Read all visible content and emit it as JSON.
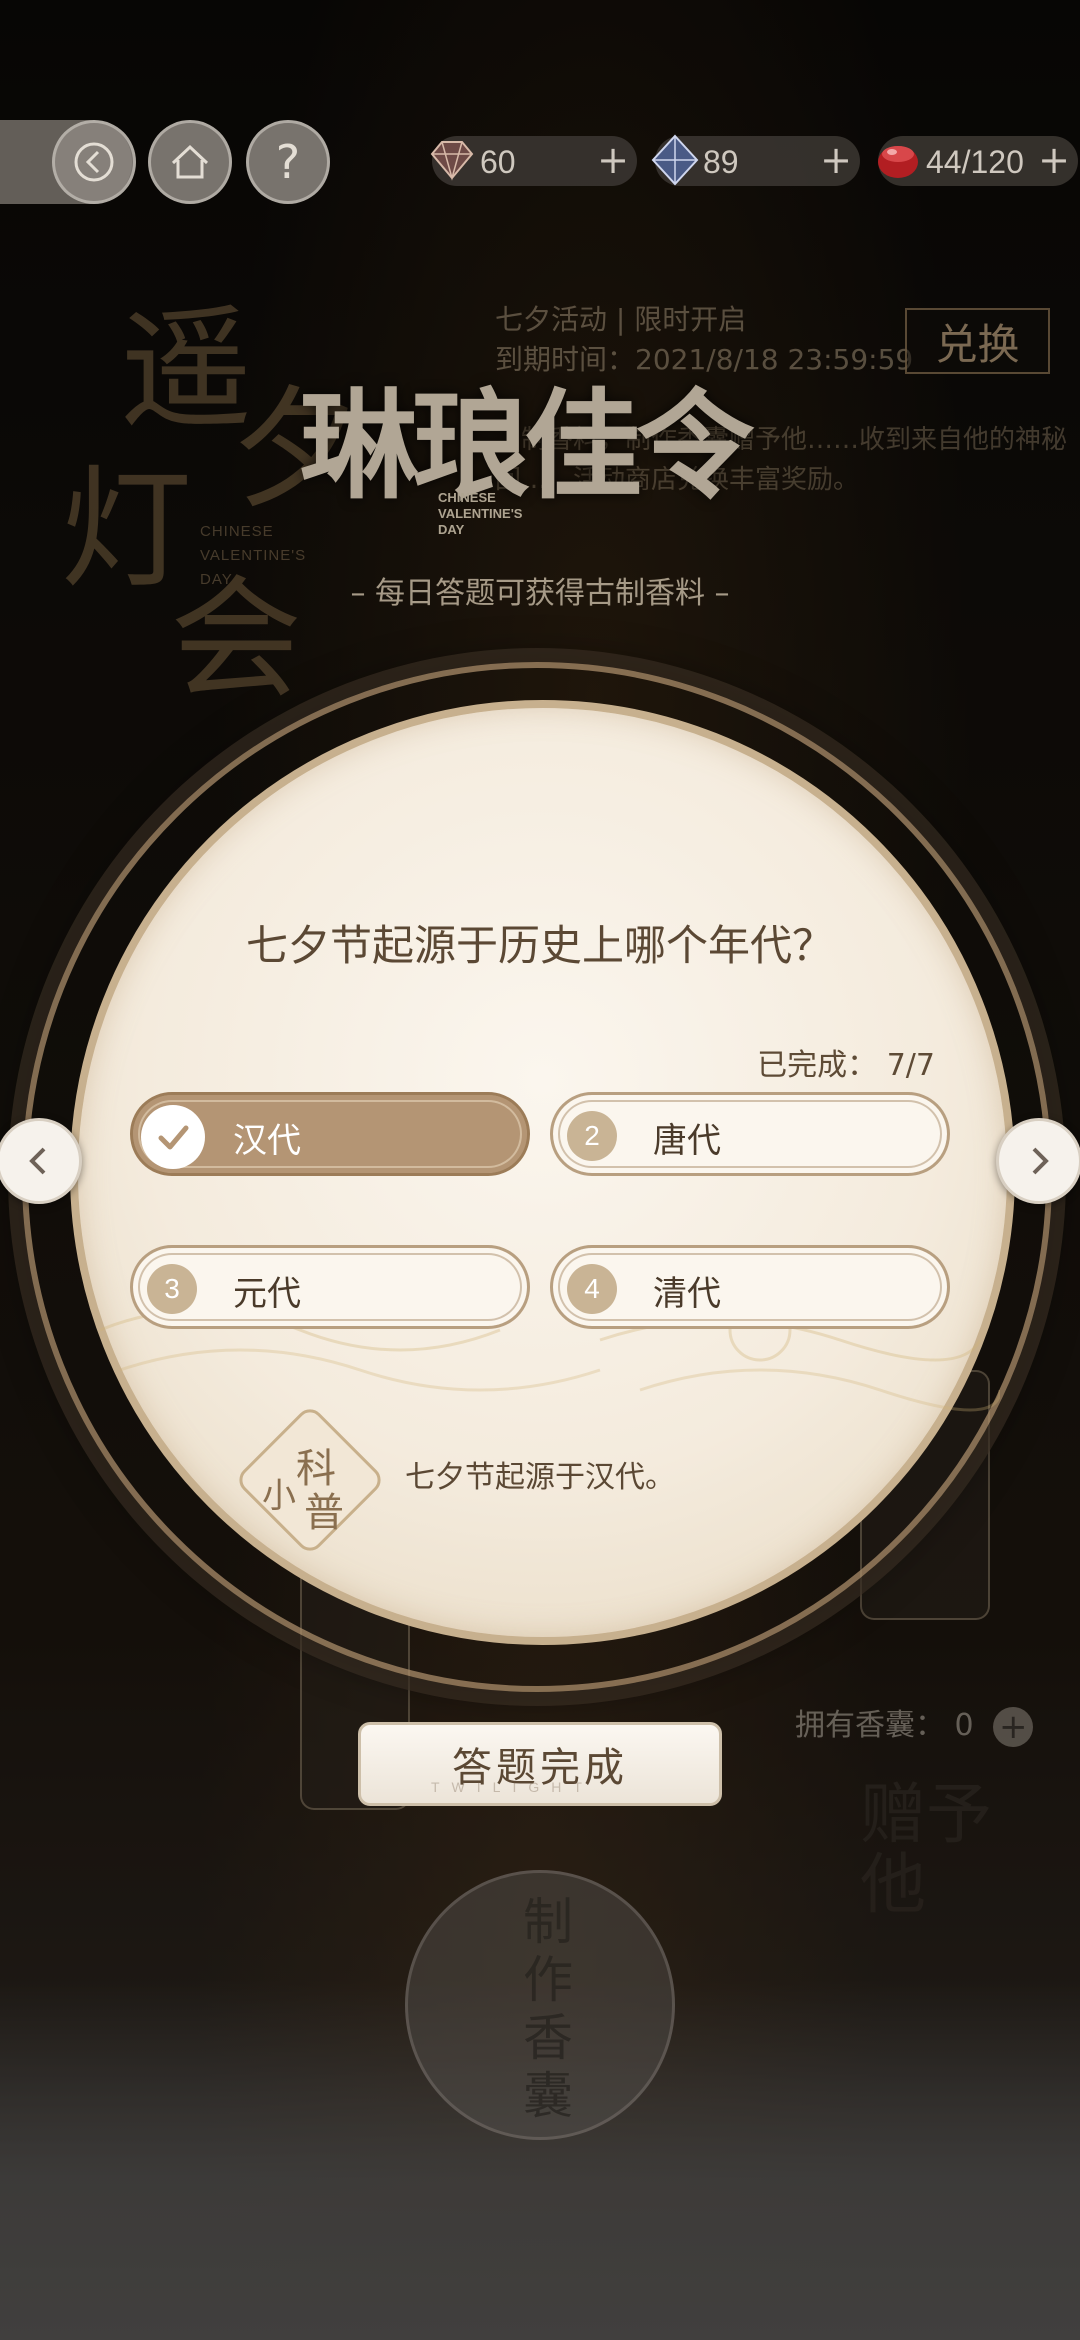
{
  "top_bar": {
    "currencies": [
      {
        "icon": "gem-icon",
        "value": "60",
        "add": "+"
      },
      {
        "icon": "crystal-icon",
        "value": "89",
        "add": "+"
      },
      {
        "icon": "stamina-icon",
        "value": "44/120",
        "add": "+"
      }
    ],
    "help_label": "?"
  },
  "event": {
    "bg_title_chars": [
      "遥",
      "夕",
      "灯",
      "会"
    ],
    "bg_title_en": "CHINESE\nVALENTINE'S\nDAY",
    "info_line1": "七夕活动 | 限时开启",
    "info_line2": "到期时间：2021/8/18 23:59:59",
    "exchange_label": "兑换",
    "desc": "…制香料，制作香囊赠予他……收到来自他的神秘回……活动商店兑换丰富奖励。",
    "logo_title": "琳琅佳令",
    "logo_en": "CHINESE\nVALENTINE'S\nDAY",
    "subtitle": "– 每日答题可获得古制香料 –"
  },
  "quiz": {
    "question": "七夕节起源于历史上哪个年代？",
    "progress_label": "已完成：",
    "progress_value": "7/7",
    "options": [
      {
        "number": "1",
        "label": "汉代",
        "correct": true
      },
      {
        "number": "2",
        "label": "唐代",
        "correct": false
      },
      {
        "number": "3",
        "label": "元代",
        "correct": false
      },
      {
        "number": "4",
        "label": "清代",
        "correct": false
      }
    ],
    "trivia_badge": {
      "small": "小",
      "big1": "科",
      "big2": "普"
    },
    "trivia_text": "七夕节起源于汉代。",
    "done_button": "答题完成",
    "done_watermark": "TWILIGHT"
  },
  "background_items": {
    "own_sachet_label": "拥有香囊：",
    "own_sachet_value": "0",
    "make_sachet": "制作香囊",
    "gift_him": "赠予他"
  },
  "colors": {
    "accent": "#b49574",
    "text_brown": "#5b4834",
    "disc": "#f4ebdd"
  }
}
